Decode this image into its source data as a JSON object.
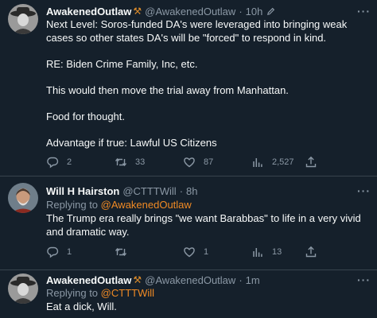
{
  "tweets": [
    {
      "name": "AwakenedOutlaw",
      "badge_icon": "pick-hammer-icon",
      "handle": "@AwakenedOutlaw",
      "time": "10h",
      "edited_icon": "pencil-icon",
      "paragraphs": [
        "Next Level: Soros-funded DA's were leveraged into bringing weak cases so other states DA's will be \"forced\" to respond in kind.",
        "RE: Biden Crime Family, Inc, etc.",
        "This would then move the trial away from Manhattan.",
        "Food for thought.",
        "Advantage if true: Lawful US Citizens"
      ],
      "replies": "2",
      "retweets": "33",
      "likes": "87",
      "views": "2,527"
    },
    {
      "name": "Will H Hairston",
      "handle": "@CTTTWill",
      "time": "8h",
      "replying_prefix": "Replying to",
      "replying_to": "@AwakenedOutlaw",
      "text": "The Trump era really brings \"we want Barabbas\" to life in a very vivid and dramatic way.",
      "replies": "1",
      "retweets": "",
      "likes": "1",
      "views": "13"
    },
    {
      "name": "AwakenedOutlaw",
      "badge_icon": "pick-hammer-icon",
      "handle": "@AwakenedOutlaw",
      "time": "1m",
      "replying_prefix": "Replying to",
      "replying_to": "@CTTTWill",
      "text": "Eat a dick, Will."
    }
  ],
  "separator": "·",
  "more_label": "···",
  "colors": {
    "background": "#15202b",
    "text": "#f7f9f9",
    "muted": "#8b98a5",
    "mention": "#f08a24",
    "divider": "#38444d"
  }
}
